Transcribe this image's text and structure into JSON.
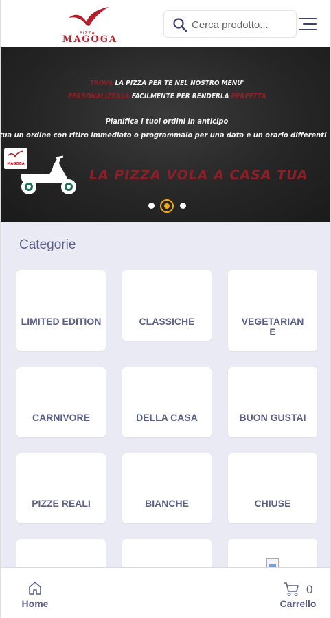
{
  "header": {
    "logo_small": "PIZZA",
    "logo_text": "MAGOGA",
    "search_placeholder": "Cerca prodotto..."
  },
  "banner": {
    "line1_red": "TROVA",
    "line1_white": " LA PIZZA PER TE NEL NOSTRO MENU'",
    "line2_red": "PERSONALIZZALA",
    "line2_white": " FACILMENTE PER RENDERLA ",
    "line2_red2": "PERFETTA",
    "line3": "Pianifica i tuoi ordini in anticipo",
    "line4": "ttua un ordine con ritiro immediato o programmalo per una data e un orario differenti",
    "tagline": "LA PIZZA VOLA A CASA TUA",
    "scooter_box_text": "MAGOGA",
    "slides": 3,
    "active_slide": 2,
    "accent_color": "#f0a818",
    "red_color": "#8c1f27"
  },
  "categories": {
    "title": "Categorie",
    "items": [
      {
        "label": "LIMITED EDITION"
      },
      {
        "label": "CLASSICHE"
      },
      {
        "label": "VEGETARIANE"
      },
      {
        "label": "CARNIVORE"
      },
      {
        "label": "DELLA CASA"
      },
      {
        "label": "BUON GUSTAI"
      },
      {
        "label": "PIZZE REALI"
      },
      {
        "label": "BIANCHE"
      },
      {
        "label": "CHIUSE"
      },
      {
        "label": ""
      },
      {
        "label": ""
      },
      {
        "label": ""
      }
    ]
  },
  "bottom_nav": {
    "home_label": "Home",
    "cart_label": "Carrello",
    "cart_count": "0"
  },
  "colors": {
    "primary_text": "#5b6088",
    "brand_red": "#b31e2b",
    "background": "#e9eaf4"
  }
}
